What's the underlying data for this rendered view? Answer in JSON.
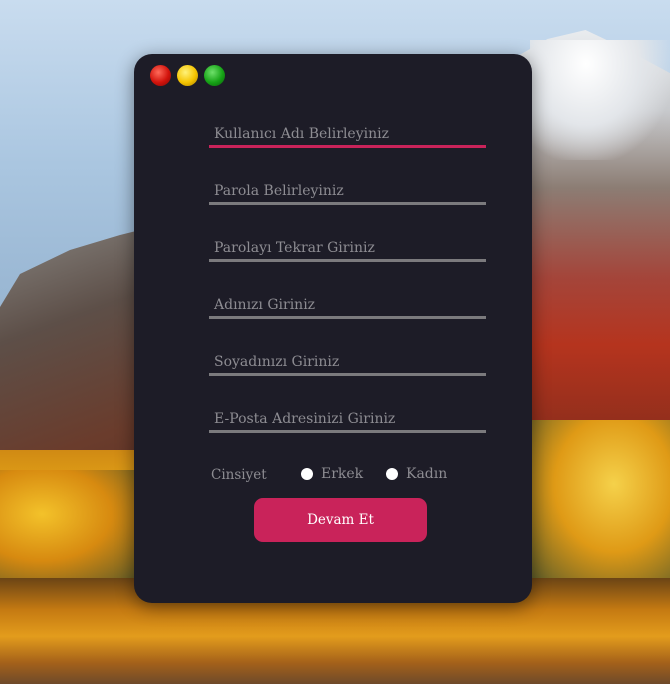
{
  "form": {
    "fields": [
      {
        "placeholder": "Kullanıcı Adı Belirleyiniz",
        "active": true
      },
      {
        "placeholder": "Parola Belirleyiniz",
        "active": false
      },
      {
        "placeholder": "Parolayı Tekrar Giriniz",
        "active": false
      },
      {
        "placeholder": "Adınızı Giriniz",
        "active": false
      },
      {
        "placeholder": "Soyadınızı Giriniz",
        "active": false
      },
      {
        "placeholder": "E-Posta Adresinizi Giriniz",
        "active": false
      }
    ],
    "gender": {
      "label": "Cinsiyet",
      "options": [
        "Erkek",
        "Kadın"
      ]
    },
    "submit_label": "Devam Et"
  },
  "colors": {
    "window_bg": "#1d1c27",
    "accent": "#c9235a",
    "underline": "#7b7a7d",
    "text_muted": "#8d8c92"
  },
  "icons": {
    "window_controls": [
      "close-icon",
      "minimize-icon",
      "maximize-icon"
    ]
  }
}
